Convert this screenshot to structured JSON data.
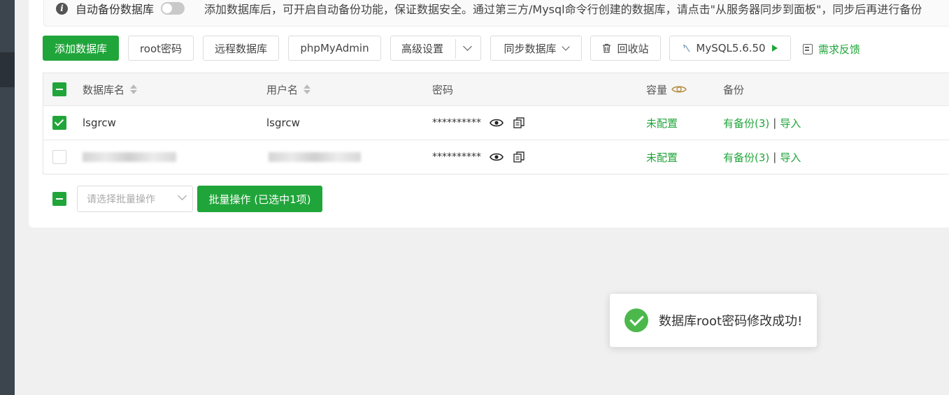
{
  "info_bar": {
    "auto_backup_label": "自动备份数据库",
    "notice": "添加数据库后，可开启自动备份功能，保证数据安全。通过第三方/Mysql命令行创建的数据库，请点击\"从服务器同步到面板\"，同步后再进行备份"
  },
  "toolbar": {
    "add_db": "添加数据库",
    "root_password": "root密码",
    "remote_db": "远程数据库",
    "phpmyadmin": "phpMyAdmin",
    "advanced": "高级设置",
    "sync_db": "同步数据库",
    "recycle_bin": "回收站",
    "mysql_version": "MySQL5.6.50",
    "feedback": "需求反馈"
  },
  "table": {
    "headers": {
      "db_name": "数据库名",
      "username": "用户名",
      "password": "密码",
      "capacity": "容量",
      "backup": "备份"
    },
    "rows": [
      {
        "db_name": "lsgrcw",
        "username": "lsgrcw",
        "password": "**********",
        "capacity": "未配置",
        "backup": "有备份(3)",
        "import": "导入",
        "checked": true
      },
      {
        "db_name": "",
        "username": "",
        "password": "**********",
        "capacity": "未配置",
        "backup": "有备份(3)",
        "import": "导入",
        "checked": false
      }
    ],
    "sep": "|"
  },
  "batch": {
    "placeholder": "请选择批量操作",
    "button": "批量操作 (已选中1项)"
  },
  "toast": {
    "message": "数据库root密码修改成功!"
  },
  "colors": {
    "accent": "#20a53a",
    "sidebar": "#3c444d"
  }
}
